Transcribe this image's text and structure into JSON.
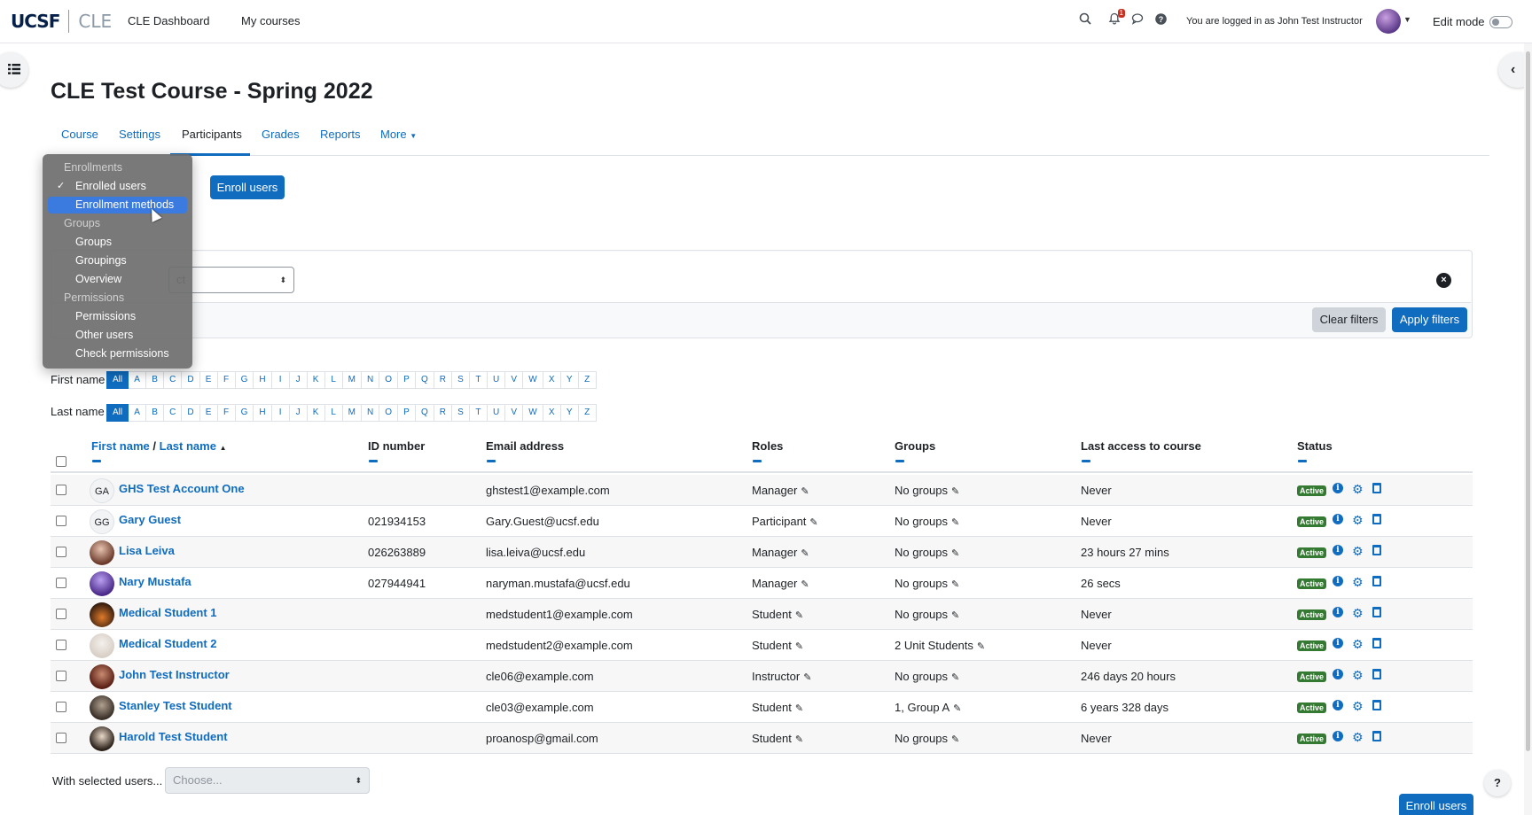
{
  "navbar": {
    "logo_primary": "UCSF",
    "logo_secondary": "CLE",
    "links": [
      "CLE Dashboard",
      "My courses"
    ],
    "notification_count": "1",
    "logged_in_text": "You are logged in as John Test Instructor",
    "edit_mode_label": "Edit mode"
  },
  "page": {
    "title": "CLE Test Course - Spring 2022",
    "tabs": [
      "Course",
      "Settings",
      "Participants",
      "Grades",
      "Reports",
      "More"
    ],
    "active_tab": "Participants"
  },
  "enroll_button": "Enroll users",
  "filter": {
    "select_partial": "ct",
    "clear_label": "Clear filters",
    "apply_label": "Apply filters"
  },
  "initials": {
    "first_label": "First name",
    "last_label": "Last name",
    "letters": [
      "All",
      "A",
      "B",
      "C",
      "D",
      "E",
      "F",
      "G",
      "H",
      "I",
      "J",
      "K",
      "L",
      "M",
      "N",
      "O",
      "P",
      "Q",
      "R",
      "S",
      "T",
      "U",
      "V",
      "W",
      "X",
      "Y",
      "Z"
    ]
  },
  "table": {
    "headers": {
      "first_name": "First name",
      "separator": "/",
      "last_name": "Last name",
      "id_number": "ID number",
      "email": "Email address",
      "roles": "Roles",
      "groups": "Groups",
      "last_access": "Last access to course",
      "status": "Status"
    },
    "status_badge": "Active",
    "rows": [
      {
        "initials": "GA",
        "name": "GHS Test Account One",
        "id": "",
        "email": "ghstest1@example.com",
        "role": "Manager",
        "groups": "No groups",
        "last_access": "Never"
      },
      {
        "initials": "GG",
        "name": "Gary Guest",
        "id": "021934153",
        "email": "Gary.Guest@ucsf.edu",
        "role": "Participant",
        "groups": "No groups",
        "last_access": "Never"
      },
      {
        "initials": "",
        "name": "Lisa Leiva",
        "id": "026263889",
        "email": "lisa.leiva@ucsf.edu",
        "role": "Manager",
        "groups": "No groups",
        "last_access": "23 hours 27 mins"
      },
      {
        "initials": "",
        "name": "Nary Mustafa",
        "id": "027944941",
        "email": "naryman.mustafa@ucsf.edu",
        "role": "Manager",
        "groups": "No groups",
        "last_access": "26 secs"
      },
      {
        "initials": "",
        "name": "Medical Student 1",
        "id": "",
        "email": "medstudent1@example.com",
        "role": "Student",
        "groups": "No groups",
        "last_access": "Never"
      },
      {
        "initials": "",
        "name": "Medical Student 2",
        "id": "",
        "email": "medstudent2@example.com",
        "role": "Student",
        "groups": "2 Unit Students",
        "last_access": "Never"
      },
      {
        "initials": "",
        "name": "John Test Instructor",
        "id": "",
        "email": "cle06@example.com",
        "role": "Instructor",
        "groups": "No groups",
        "last_access": "246 days 20 hours"
      },
      {
        "initials": "",
        "name": "Stanley Test Student",
        "id": "",
        "email": "cle03@example.com",
        "role": "Student",
        "groups": "1, Group A",
        "last_access": "6 years 328 days"
      },
      {
        "initials": "",
        "name": "Harold Test Student",
        "id": "",
        "email": "proanosp@gmail.com",
        "role": "Student",
        "groups": "No groups",
        "last_access": "Never"
      }
    ]
  },
  "bottom": {
    "with_selected": "With selected users...",
    "choose_placeholder": "Choose...",
    "enroll_button": "Enroll users",
    "help": "?"
  },
  "dropdown": {
    "groups": [
      {
        "heading": "Enrollments",
        "items": [
          "Enrolled users",
          "Enrollment methods"
        ]
      },
      {
        "heading": "Groups",
        "items": [
          "Groups",
          "Groupings",
          "Overview"
        ]
      },
      {
        "heading": "Permissions",
        "items": [
          "Permissions",
          "Other users",
          "Check permissions"
        ]
      }
    ],
    "checked_item": "Enrolled users",
    "highlighted_item": "Enrollment methods"
  },
  "colors": {
    "primary": "#0f6cbf",
    "active_badge": "#357a32",
    "menu_highlight": "#3b7be0"
  }
}
